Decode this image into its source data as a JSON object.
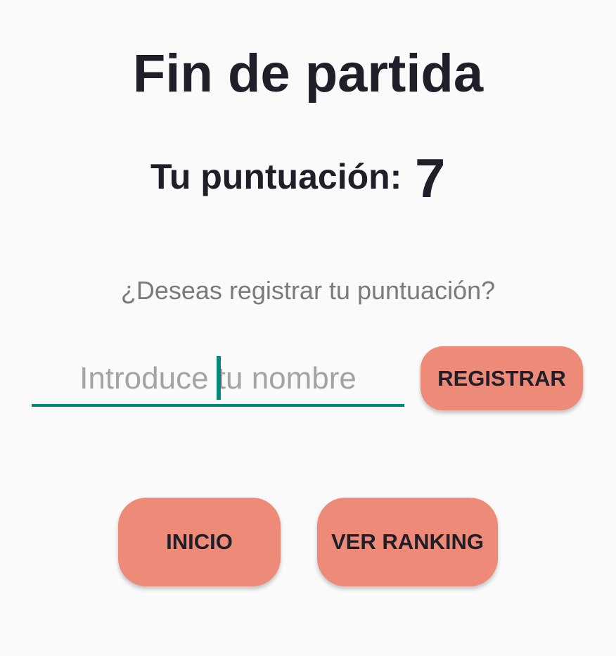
{
  "title": "Fin de partida",
  "score": {
    "label": "Tu puntuación:",
    "value": "7"
  },
  "register_prompt": "¿Deseas registrar tu puntuación?",
  "name_input": {
    "value": "",
    "placeholder": "Introduce tu nombre"
  },
  "buttons": {
    "register": "REGISTRAR",
    "home": "INICIO",
    "ranking": "VER RANKING"
  },
  "colors": {
    "accent": "#00897b",
    "button": "#ee8a78",
    "text": "#1f1e29",
    "muted": "#7a7a7a",
    "background": "#fafafa"
  }
}
